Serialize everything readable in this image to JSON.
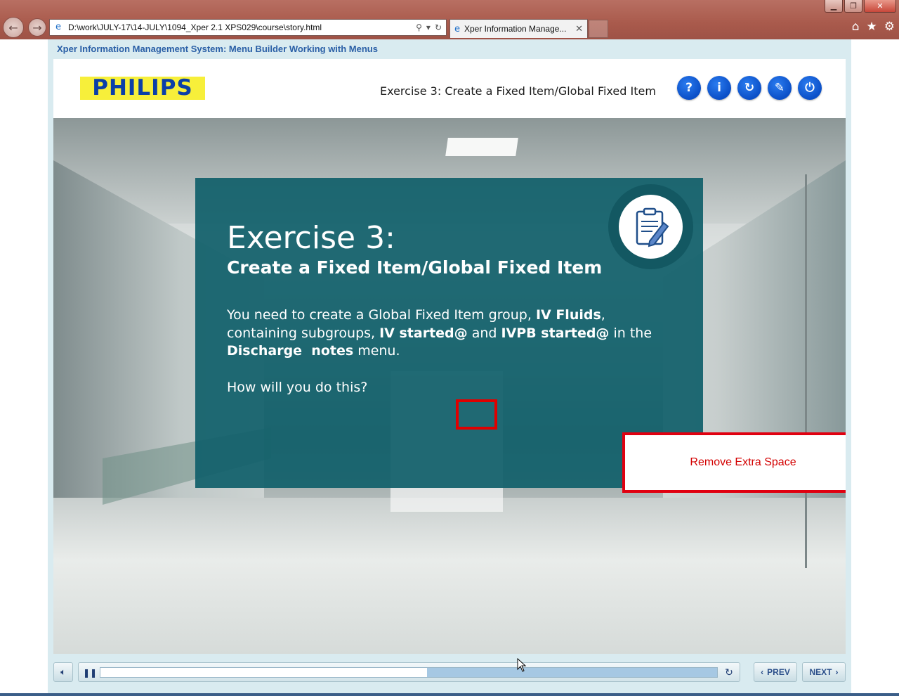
{
  "browser": {
    "address_url": "D:\\work\\JULY-17\\14-JULY\\1094_Xper 2.1 XPS029\\course\\story.html",
    "tab_title": "Xper Information Manage...",
    "tab_close": "✕",
    "window_minimize": "▁",
    "window_maximize": "❐",
    "window_close": "✕"
  },
  "course": {
    "title": "Xper Information Management System: Menu Builder Working with Menus",
    "logo_text": "PHILIPS",
    "header_exercise": "Exercise 3: Create a Fixed Item/Global Fixed Item",
    "header_buttons": [
      {
        "name": "help-icon",
        "glyph": "?"
      },
      {
        "name": "info-icon",
        "glyph": "i"
      },
      {
        "name": "refresh-icon",
        "glyph": "↻"
      },
      {
        "name": "feather-icon",
        "glyph": "✎"
      },
      {
        "name": "power-icon",
        "glyph": "⏻"
      }
    ]
  },
  "slide": {
    "title": "Exercise 3:",
    "subtitle": "Create a Fixed Item/Global Fixed Item",
    "body_parts": {
      "p1": "You need to create a Global Fixed Item group, ",
      "b1": "IV Fluids",
      "p2": ", containing subgroups, ",
      "b2": "IV started@",
      "p3": " and ",
      "b3": "IVPB started@",
      "p4": " in the ",
      "b4": "Discharge  notes",
      "p5": " menu."
    },
    "question": "How will you do this?",
    "annotation": "Remove Extra Space"
  },
  "player": {
    "prev_label": "PREV",
    "next_label": "NEXT",
    "progress": 0.53
  },
  "colors": {
    "card_bg": "#11606b",
    "header_button": "#0b4fc7",
    "annotation_red": "#e00010",
    "course_title": "#2a5fa6"
  }
}
